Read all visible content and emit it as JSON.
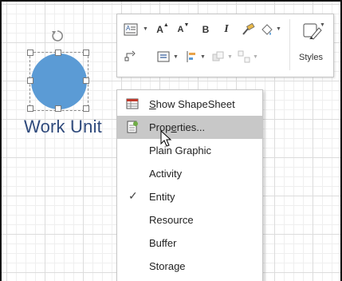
{
  "shape": {
    "text": "Work Unit",
    "fill_color": "#5b9bd5",
    "text_color": "#2f4a7c"
  },
  "mini_toolbar": {
    "styles_label": "Styles",
    "buttons_row1": [
      "text-format-icon",
      "grow-font-icon",
      "shrink-font-icon",
      "bold-button",
      "italic-button",
      "format-painter-icon",
      "shape-fill-icon",
      "styles-icon"
    ],
    "bold_label": "B",
    "italic_label": "I",
    "grow_label": "A",
    "shrink_label": "A",
    "buttons_row2": [
      "connector-icon",
      "align-icon",
      "position-icon",
      "bring-forward-icon",
      "group-icon"
    ]
  },
  "context_menu": {
    "items": [
      {
        "label": "Show ShapeSheet",
        "accel_prefix": "",
        "accel": "S",
        "rest": "how ShapeSheet",
        "icon": "shapesheet-icon",
        "highlighted": false,
        "checked": false
      },
      {
        "label": "Properties...",
        "accel_prefix": "Prop",
        "accel": "e",
        "rest": "rties...",
        "icon": "properties-icon",
        "highlighted": true,
        "checked": false
      },
      {
        "label": "Plain Graphic",
        "icon": "",
        "highlighted": false,
        "checked": false
      },
      {
        "label": "Activity",
        "icon": "",
        "highlighted": false,
        "checked": false
      },
      {
        "label": "Entity",
        "icon": "",
        "highlighted": false,
        "checked": true
      },
      {
        "label": "Resource",
        "icon": "",
        "highlighted": false,
        "checked": false
      },
      {
        "label": "Buffer",
        "icon": "",
        "highlighted": false,
        "checked": false
      },
      {
        "label": "Storage",
        "icon": "",
        "highlighted": false,
        "checked": false
      }
    ],
    "highlight_color": "#c8c8c8"
  }
}
